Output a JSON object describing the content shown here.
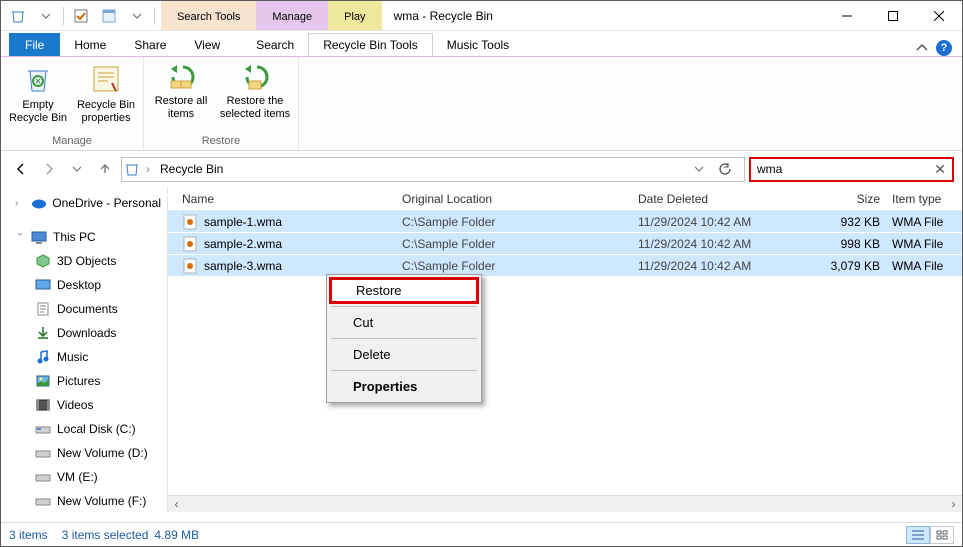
{
  "titlebar": {
    "title": "wma - Recycle Bin"
  },
  "context_tabs": {
    "search": "Search Tools",
    "manage": "Manage",
    "play": "Play"
  },
  "ribbon_tabs": {
    "file": "File",
    "home": "Home",
    "share": "Share",
    "view": "View",
    "search": "Search",
    "recycle_bin_tools": "Recycle Bin Tools",
    "music_tools": "Music Tools"
  },
  "ribbon": {
    "manage": {
      "empty": "Empty Recycle Bin",
      "properties": "Recycle Bin properties",
      "label": "Manage"
    },
    "restore": {
      "all": "Restore all items",
      "selected": "Restore the selected items",
      "label": "Restore"
    }
  },
  "address": {
    "crumb": "Recycle Bin"
  },
  "search": {
    "value": "wma"
  },
  "sidebar": {
    "onedrive": "OneDrive - Personal",
    "this_pc": "This PC",
    "objects3d": "3D Objects",
    "desktop": "Desktop",
    "documents": "Documents",
    "downloads": "Downloads",
    "music": "Music",
    "pictures": "Pictures",
    "videos": "Videos",
    "local_c": "Local Disk (C:)",
    "new_d": "New Volume (D:)",
    "vm_e": "VM (E:)",
    "new_f": "New Volume (F:)"
  },
  "columns": {
    "name": "Name",
    "orig": "Original Location",
    "date": "Date Deleted",
    "size": "Size",
    "type": "Item type"
  },
  "rows": [
    {
      "name": "sample-1.wma",
      "orig": "C:\\Sample Folder",
      "date": "11/29/2024 10:42 AM",
      "size": "932 KB",
      "type": "WMA File"
    },
    {
      "name": "sample-2.wma",
      "orig": "C:\\Sample Folder",
      "date": "11/29/2024 10:42 AM",
      "size": "998 KB",
      "type": "WMA File"
    },
    {
      "name": "sample-3.wma",
      "orig": "C:\\Sample Folder",
      "date": "11/29/2024 10:42 AM",
      "size": "3,079 KB",
      "type": "WMA File"
    }
  ],
  "context_menu": {
    "restore": "Restore",
    "cut": "Cut",
    "delete": "Delete",
    "properties": "Properties"
  },
  "status": {
    "count": "3 items",
    "selected": "3 items selected",
    "size": "4.89 MB"
  }
}
